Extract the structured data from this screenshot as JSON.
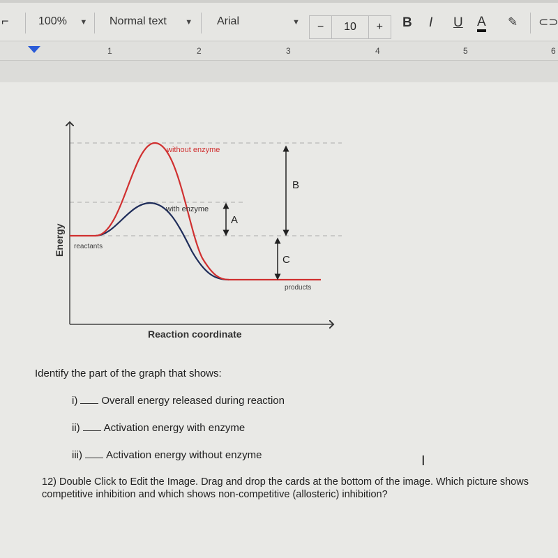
{
  "toolbar": {
    "zoom": "100%",
    "style": "Normal text",
    "font": "Arial",
    "font_size": "10",
    "decrease_label": "−",
    "increase_label": "+",
    "bold_label": "B",
    "italic_label": "I",
    "underline_label": "U",
    "text_color_label": "A"
  },
  "ruler": {
    "numbers": [
      "1",
      "2",
      "3",
      "4",
      "5",
      "6"
    ]
  },
  "diagram": {
    "ylabel": "Energy",
    "xlabel": "Reaction coordinate",
    "curve_without": "without enzyme",
    "curve_with": "with enzyme",
    "reactants": "reactants",
    "products": "products",
    "label_a": "A",
    "label_b": "B",
    "label_c": "C",
    "colors": {
      "without": "#d03030",
      "with": "#1f2d5a"
    }
  },
  "question": {
    "prompt": "Identify the part of the graph that shows:",
    "items": [
      {
        "num": "i)",
        "text": "Overall energy released during reaction"
      },
      {
        "num": "ii)",
        "text": "Activation energy with enzyme"
      },
      {
        "num": "iii)",
        "text": "Activation energy without enzyme"
      }
    ]
  },
  "next_question": "12) Double Click to Edit the Image. Drag and drop the cards at the bottom of the image. Which picture shows competitive inhibition and which shows non-competitive (allosteric) inhibition?"
}
